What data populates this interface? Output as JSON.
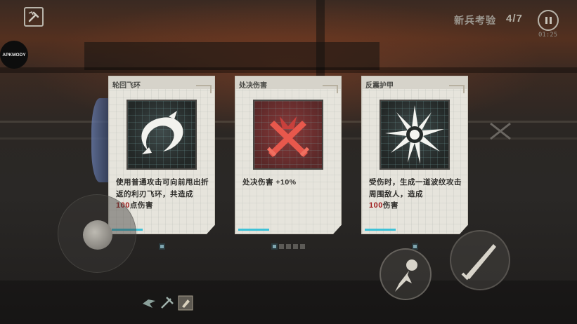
{
  "header": {
    "stage_title": "新兵考验",
    "wave_count": "4/7",
    "timer": "01:25"
  },
  "watermark": "APKMODY",
  "cards": [
    {
      "title": "轮回飞环",
      "icon": "ring-blade-icon",
      "desc_line1": "使用普通攻击可向前甩出折返的利刃飞环，共造成",
      "value": "100",
      "desc_suffix": "点伤害",
      "selected": true
    },
    {
      "title": "处决伤害",
      "icon": "crossed-swords-icon",
      "desc_line1": "处决伤害 +10%",
      "value": "",
      "desc_suffix": "",
      "selected": true
    },
    {
      "title": "反震护甲",
      "icon": "shockwave-icon",
      "desc_line1": "受伤时，生成一道波纹攻击周围敌人，造成",
      "value": "100",
      "desc_suffix": "伤害",
      "selected": true
    }
  ],
  "pagination": {
    "current": 1,
    "total": 5
  },
  "colors": {
    "accent_cyan": "#3ec2d8",
    "damage_red": "#a11f1f",
    "card_bg": "#e6e4dc"
  },
  "controls": {
    "joystick": "move-joystick",
    "dodge": "dodge-skill-icon",
    "attack": "sword-attack-icon"
  }
}
